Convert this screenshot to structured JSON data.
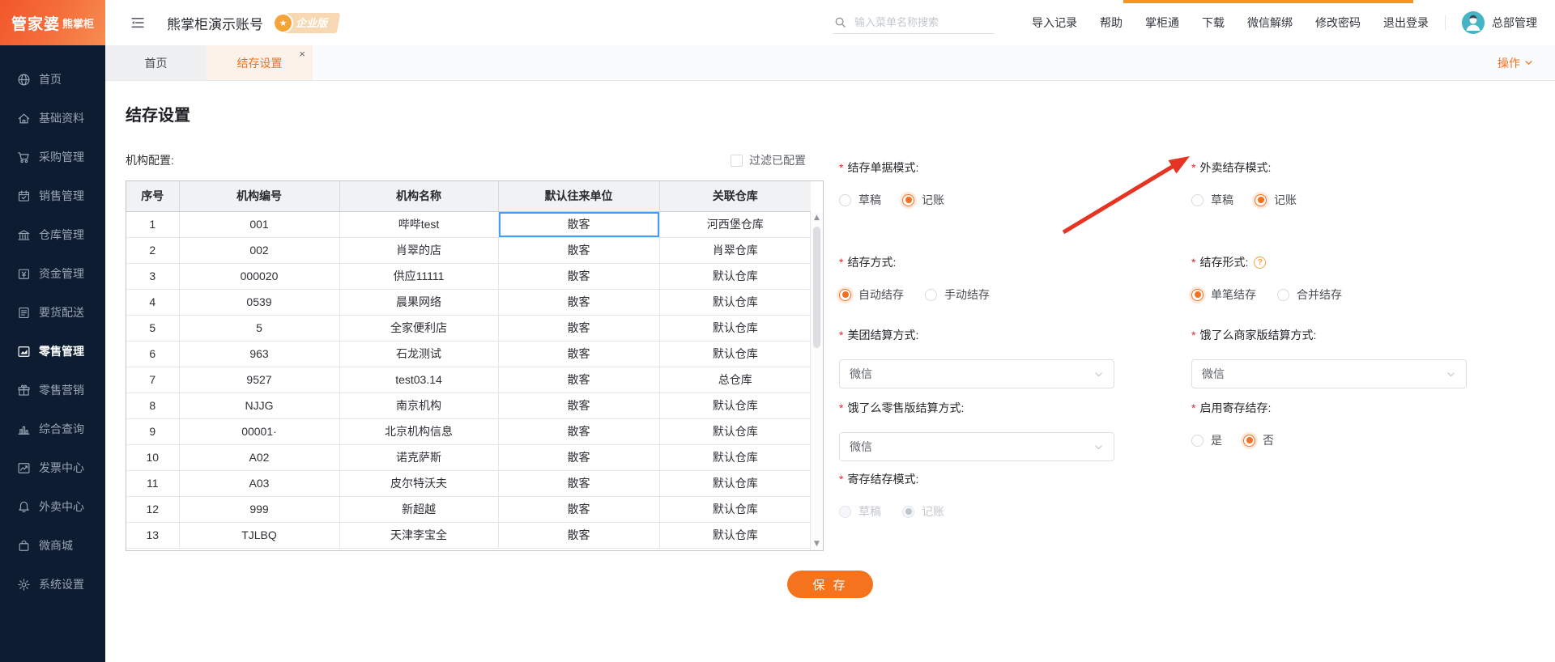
{
  "colors": {
    "accent_orange": "#f3701f",
    "sidebar_bg": "#0d1c30",
    "annotation_arrow_red": "#e63322",
    "selected_cell_blue": "#3f9eff",
    "top_progress_bar": "#f7941e"
  },
  "header": {
    "logo_brand": "管家婆",
    "logo_product": "熊掌柜",
    "account_title": "熊掌柜演示账号",
    "badge_label": "企业版",
    "search_placeholder": "输入菜单名称搜索",
    "links": [
      "导入记录",
      "帮助",
      "掌柜通",
      "下载",
      "微信解绑",
      "修改密码",
      "退出登录"
    ],
    "user_name": "总部管理"
  },
  "sidebar": {
    "items": [
      {
        "label": "首页",
        "icon": "globe",
        "active": false
      },
      {
        "label": "基础资料",
        "icon": "home",
        "active": false
      },
      {
        "label": "采购管理",
        "icon": "cart",
        "active": false
      },
      {
        "label": "销售管理",
        "icon": "calendar",
        "active": false
      },
      {
        "label": "仓库管理",
        "icon": "bank",
        "active": false
      },
      {
        "label": "资金管理",
        "icon": "money",
        "active": false
      },
      {
        "label": "要货配送",
        "icon": "doc-list",
        "active": false
      },
      {
        "label": "零售管理",
        "icon": "chart-area",
        "active": true
      },
      {
        "label": "零售营销",
        "icon": "gift",
        "active": false
      },
      {
        "label": "综合查询",
        "icon": "bar-chart",
        "active": false
      },
      {
        "label": "发票中心",
        "icon": "trend",
        "active": false
      },
      {
        "label": "外卖中心",
        "icon": "bell",
        "active": false
      },
      {
        "label": "微商城",
        "icon": "bag",
        "active": false
      },
      {
        "label": "系统设置",
        "icon": "gear",
        "active": false
      }
    ]
  },
  "tabs": {
    "items": [
      {
        "label": "首页",
        "active": false,
        "closable": false
      },
      {
        "label": "结存设置",
        "active": true,
        "closable": true
      }
    ],
    "action_label": "操作"
  },
  "page": {
    "title": "结存设置",
    "org_config_label": "机构配置:",
    "filter_label": "过滤已配置",
    "filter_checked": false,
    "table": {
      "headers": [
        "序号",
        "机构编号",
        "机构名称",
        "默认往来单位",
        "关联仓库"
      ],
      "rows": [
        [
          "1",
          "001",
          "哔哔test",
          "散客",
          "河西堡仓库"
        ],
        [
          "2",
          "002",
          "肖翠的店",
          "散客",
          "肖翠仓库"
        ],
        [
          "3",
          "000020",
          "供应11111",
          "散客",
          "默认仓库"
        ],
        [
          "4",
          "0539",
          "晨果网络",
          "散客",
          "默认仓库"
        ],
        [
          "5",
          "5",
          "全家便利店",
          "散客",
          "默认仓库"
        ],
        [
          "6",
          "963",
          "石龙测试",
          "散客",
          "默认仓库"
        ],
        [
          "7",
          "9527",
          "test03.14",
          "散客",
          "总仓库"
        ],
        [
          "8",
          "NJJG",
          "南京机构",
          "散客",
          "默认仓库"
        ],
        [
          "9",
          "00001·",
          "北京机构信息",
          "散客",
          "默认仓库"
        ],
        [
          "10",
          "A02",
          "诺克萨斯",
          "散客",
          "默认仓库"
        ],
        [
          "11",
          "A03",
          "皮尔特沃夫",
          "散客",
          "默认仓库"
        ],
        [
          "12",
          "999",
          "新超越",
          "散客",
          "默认仓库"
        ],
        [
          "13",
          "TJLBQ",
          "天津李宝全",
          "散客",
          "默认仓库"
        ]
      ],
      "selected_cell": {
        "row_index": 0,
        "column": "默认往来单位"
      }
    },
    "settings": [
      {
        "label": "结存单据模式:",
        "type": "radio",
        "options": [
          "草稿",
          "记账"
        ],
        "selected": "记账"
      },
      {
        "label": "外卖结存模式:",
        "type": "radio",
        "options": [
          "草稿",
          "记账"
        ],
        "selected": "记账",
        "annotated_by_red_arrow": true
      },
      {
        "label": "结存方式:",
        "type": "radio",
        "options": [
          "自动结存",
          "手动结存"
        ],
        "selected": "自动结存"
      },
      {
        "label": "结存形式:",
        "type": "radio",
        "options": [
          "单笔结存",
          "合并结存"
        ],
        "selected": "单笔结存",
        "has_help_icon": true
      },
      {
        "label": "美团结算方式:",
        "type": "select",
        "value": "微信"
      },
      {
        "label": "饿了么商家版结算方式:",
        "type": "select",
        "value": "微信"
      },
      {
        "label": "饿了么零售版结算方式:",
        "type": "select",
        "value": "微信"
      },
      {
        "label": "启用寄存结存:",
        "type": "radio",
        "options": [
          "是",
          "否"
        ],
        "selected": "否"
      },
      {
        "label": "寄存结存模式:",
        "type": "radio",
        "options": [
          "草稿",
          "记账"
        ],
        "selected": "记账",
        "disabled": true
      }
    ],
    "save_button_label": "保 存"
  }
}
